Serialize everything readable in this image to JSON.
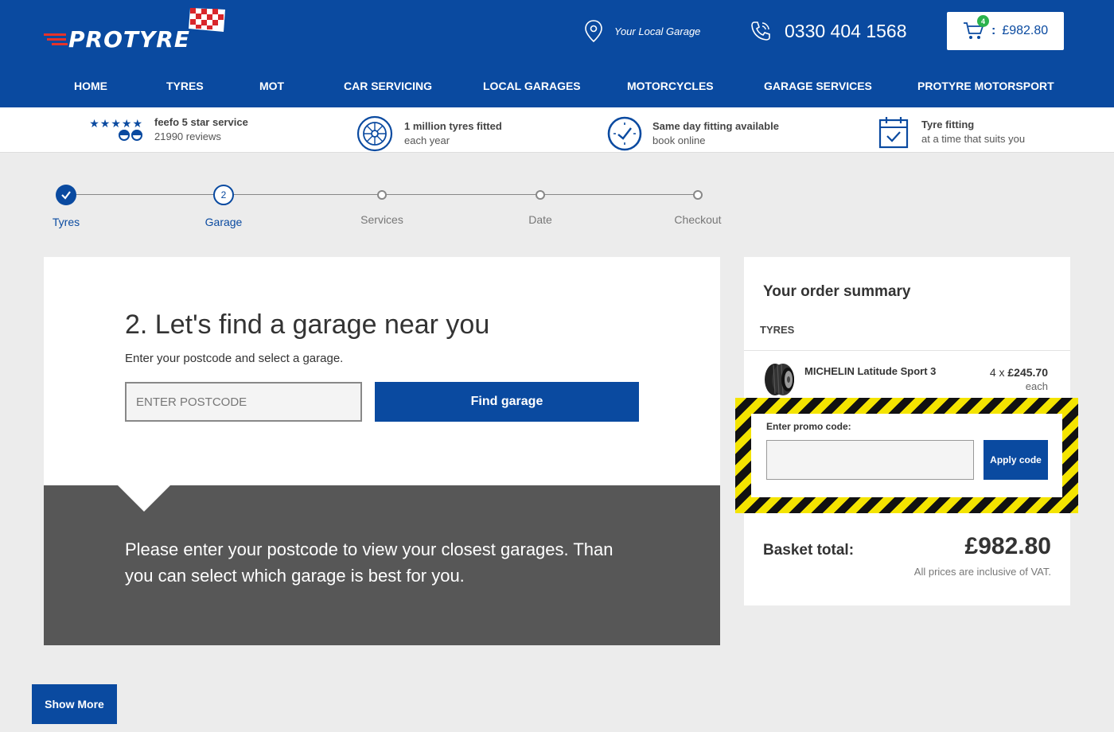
{
  "header": {
    "logo_text": "PROTYRE",
    "local_garage": "Your Local Garage",
    "phone": "0330 404 1568",
    "basket_count": "4",
    "basket_separator": ":",
    "basket_total": "£982.80",
    "brand_color": "#0a4aa0"
  },
  "nav": [
    "HOME",
    "TYRES",
    "MOT",
    "CAR SERVICING",
    "LOCAL GARAGES",
    "MOTORCYCLES",
    "GARAGE SERVICES",
    "PROTYRE MOTORSPORT"
  ],
  "benefits": [
    {
      "title": "feefo 5 star service",
      "subtitle": "21990 reviews",
      "icon": "feefo-stars-icon",
      "stars": "★★★★★"
    },
    {
      "title": "1 million tyres fitted",
      "subtitle": "each year",
      "icon": "tyre-icon"
    },
    {
      "title": "Same day fitting available",
      "subtitle": "book online",
      "icon": "clock-icon"
    },
    {
      "title": "Tyre fitting",
      "subtitle": "at a time that suits you",
      "icon": "calendar-check-icon"
    }
  ],
  "progress": {
    "steps": [
      "Tyres",
      "Garage",
      "Services",
      "Date",
      "Checkout"
    ],
    "current_step_number": "2"
  },
  "garage_finder": {
    "heading": "2. Let's find a garage near you",
    "subheading": "Enter your postcode and select a garage.",
    "postcode_placeholder": "ENTER POSTCODE",
    "find_button": "Find garage",
    "info_text": "Please enter your postcode to view your closest garages. Than you can select which garage is best for you."
  },
  "order_summary": {
    "title": "Your order summary",
    "category": "TYRES",
    "item": {
      "name": "MICHELIN Latitude Sport 3",
      "quantity_prefix": "4 x",
      "price": "£245.70",
      "unit": "each"
    },
    "promo_label": "Enter promo code:",
    "promo_value": "",
    "apply_button": "Apply code",
    "total_label": "Basket total:",
    "total_value": "£982.80",
    "vat_note": "All prices are inclusive of VAT."
  },
  "show_more": "Show More"
}
